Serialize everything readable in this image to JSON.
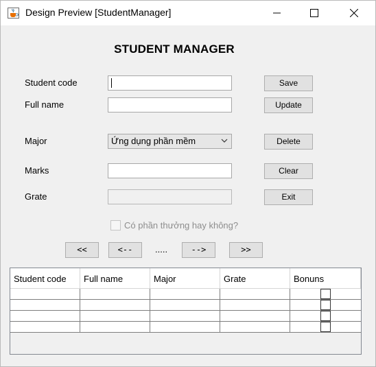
{
  "window": {
    "title": "Design Preview [StudentManager]"
  },
  "heading": "STUDENT MANAGER",
  "form": {
    "student_code_label": "Student code",
    "full_name_label": "Full name",
    "major_label": "Major",
    "marks_label": "Marks",
    "grate_label": "Grate",
    "student_code_value": "",
    "full_name_value": "",
    "major_selected": "Ứng dụng phần mềm",
    "marks_value": "",
    "grate_value": "",
    "bonus_checkbox_label": "Có phần thưởng hay không?"
  },
  "buttons": {
    "save": "Save",
    "update": "Update",
    "delete": "Delete",
    "clear": "Clear",
    "exit": "Exit"
  },
  "navigation": {
    "first": "<<",
    "prev": "<--",
    "indicator": ".....",
    "next": "-->",
    "last": ">>"
  },
  "table": {
    "columns": [
      "Student code",
      "Full name",
      "Major",
      "Grate",
      "Bonuns"
    ],
    "rows": [
      [
        "",
        "",
        "",
        "",
        ""
      ],
      [
        "",
        "",
        "",
        "",
        ""
      ],
      [
        "",
        "",
        "",
        "",
        ""
      ],
      [
        "",
        "",
        "",
        "",
        ""
      ]
    ]
  }
}
